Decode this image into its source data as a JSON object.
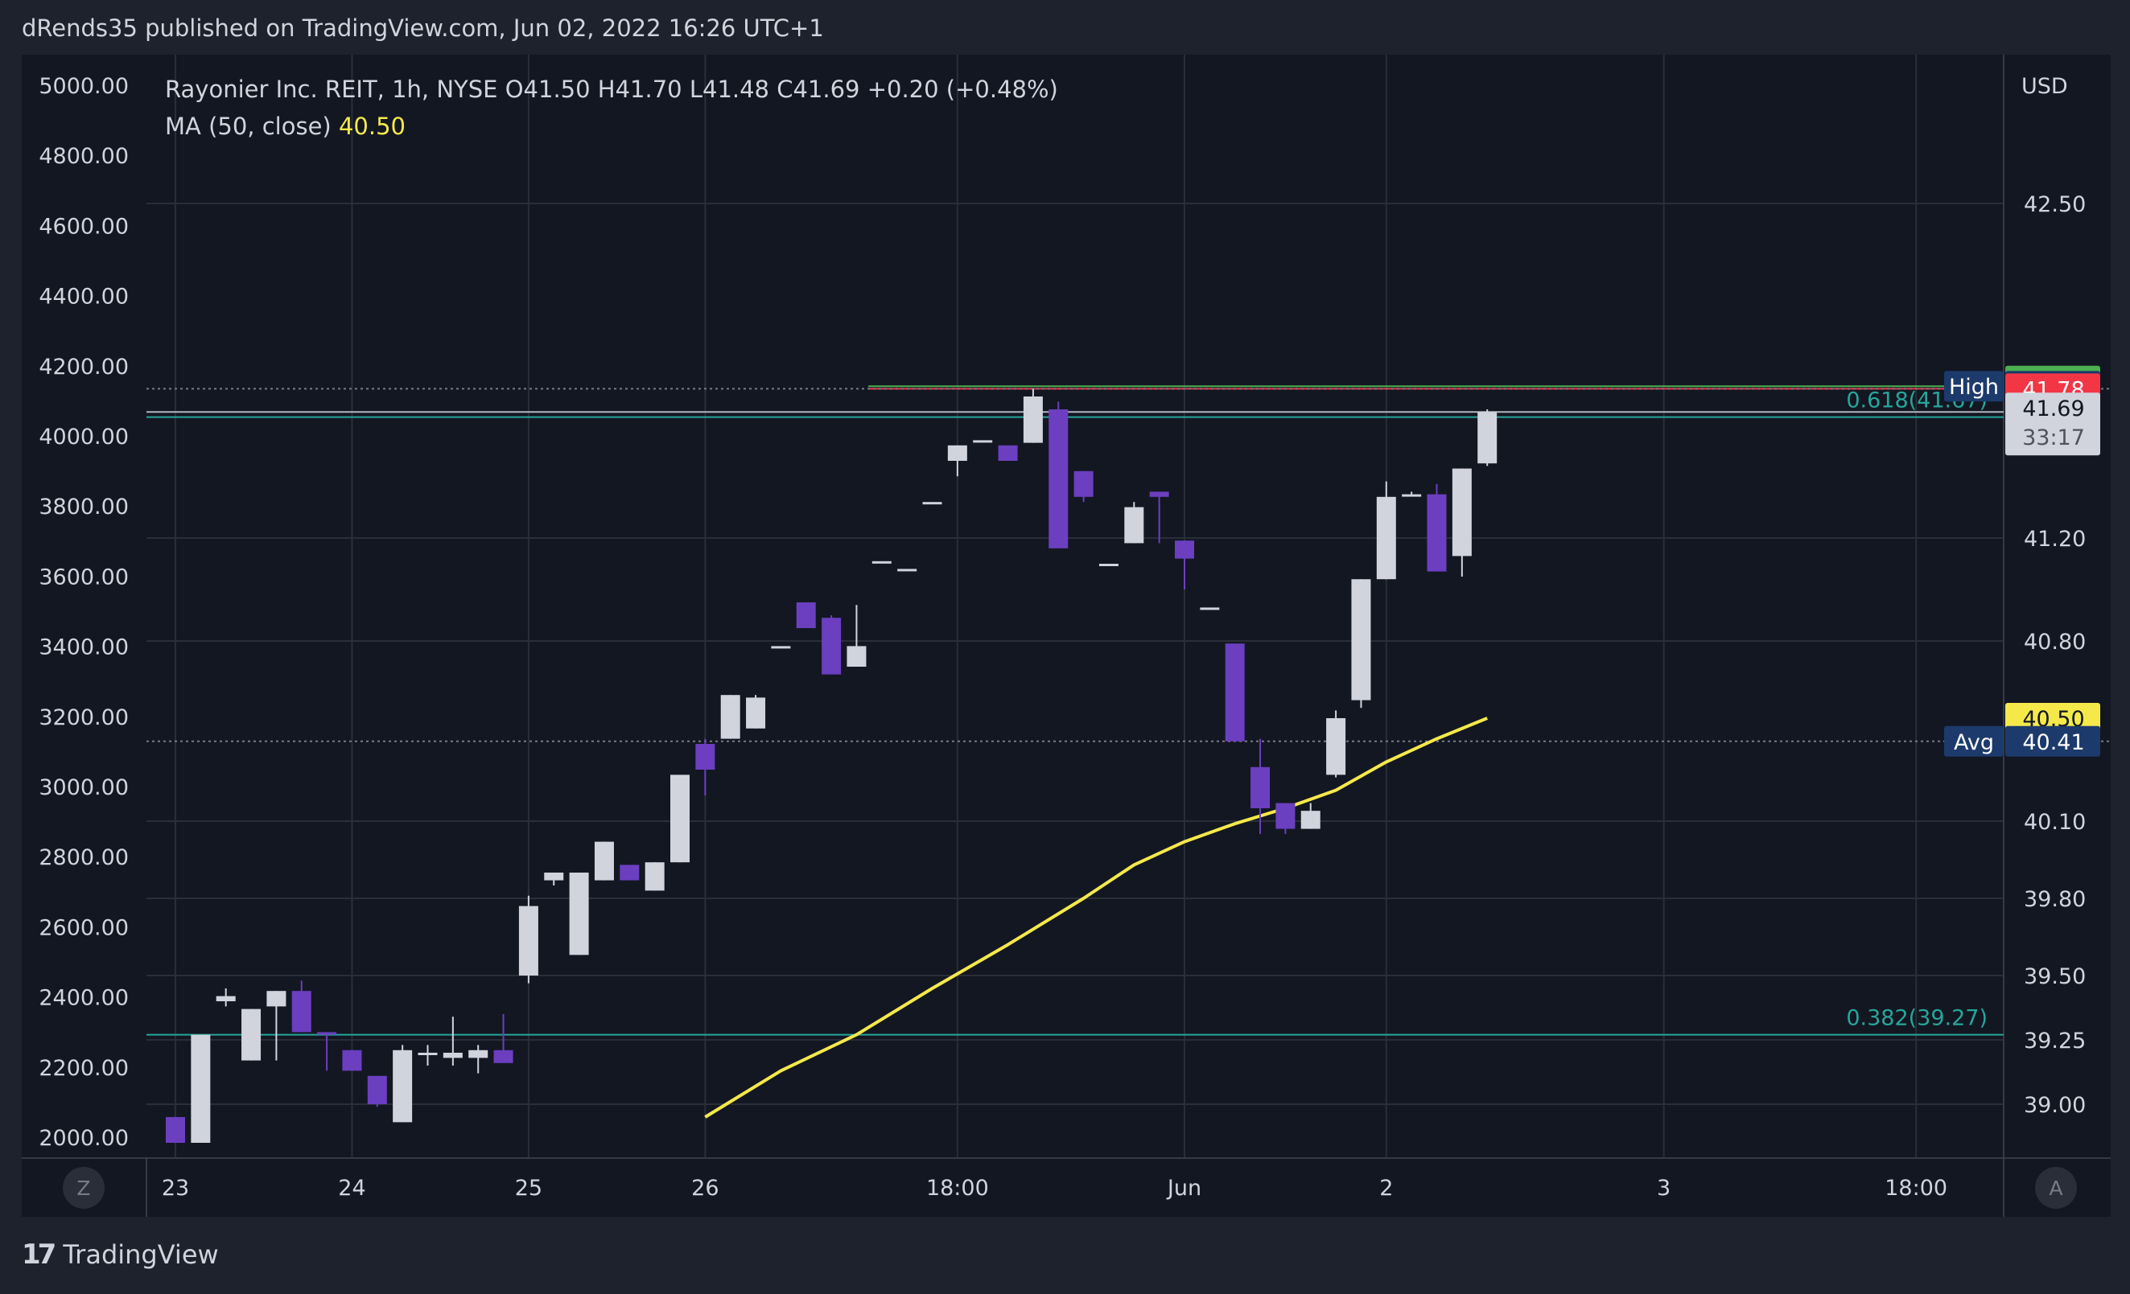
{
  "header": {
    "published_text": "dRends35 published on TradingView.com, Jun 02, 2022 16:26 UTC+1"
  },
  "legend": {
    "line1": "Rayonier Inc. REIT, 1h, NYSE  O41.50  H41.70  L41.48  C41.69  +0.20 (+0.48%)",
    "ma_label": "MA (50, close)",
    "ma_value": "40.50"
  },
  "footer": {
    "brand": "TradingView",
    "logo_icon": "tradingview-logo-icon"
  },
  "buttons": {
    "left_axis_button": "Z",
    "right_axis_button": "A"
  },
  "colors": {
    "background": "#131722",
    "up_candle": "#d1d4dc",
    "down_candle": "#6b3fc0",
    "ma_line": "#f5e94a",
    "fib_line": "#26a69a",
    "green_badge": "#4caf50",
    "red_badge": "#f23645",
    "navy_badge": "#1c3a6b"
  },
  "chart_data": {
    "type": "candlestick",
    "symbol": "Rayonier Inc. REIT",
    "interval": "1h",
    "exchange": "NYSE",
    "currency": "USD",
    "right_axis_ticks": [
      42.5,
      41.2,
      40.8,
      40.1,
      39.8,
      39.5,
      39.25,
      39.0
    ],
    "right_axis_tick_labels": [
      "42.50",
      "41.20",
      "40.80",
      "40.10",
      "39.80",
      "39.50",
      "39.25",
      "39.00"
    ],
    "left_axis_ticks": [
      5000,
      4800,
      4600,
      4400,
      4200,
      4000,
      3800,
      3600,
      3400,
      3200,
      3000,
      2800,
      2600,
      2400,
      2200,
      2000
    ],
    "left_axis_tick_labels": [
      "5000.00",
      "4800.00",
      "4600.00",
      "4400.00",
      "4200.00",
      "4000.00",
      "3800.00",
      "3600.00",
      "3400.00",
      "3200.00",
      "3000.00",
      "2800.00",
      "2600.00",
      "2400.00",
      "2200.00",
      "2000.00"
    ],
    "x_tick_labels": [
      {
        "label": "23",
        "index": 0
      },
      {
        "label": "24",
        "index": 7
      },
      {
        "label": "25",
        "index": 14
      },
      {
        "label": "26",
        "index": 21
      },
      {
        "label": "18:00",
        "index": 31
      },
      {
        "label": "Jun",
        "index": 40
      },
      {
        "label": "2",
        "index": 48
      },
      {
        "label": "3",
        "index": 59
      },
      {
        "label": "18:00",
        "index": 69
      }
    ],
    "candles": [
      {
        "o": 38.95,
        "h": 38.95,
        "l": 38.85,
        "c": 38.85
      },
      {
        "o": 38.85,
        "h": 39.27,
        "l": 38.85,
        "c": 39.27
      },
      {
        "o": 39.4,
        "h": 39.45,
        "l": 39.38,
        "c": 39.42
      },
      {
        "o": 39.17,
        "h": 39.37,
        "l": 39.17,
        "c": 39.37
      },
      {
        "o": 39.38,
        "h": 39.44,
        "l": 39.17,
        "c": 39.44
      },
      {
        "o": 39.44,
        "h": 39.48,
        "l": 39.28,
        "c": 39.28
      },
      {
        "o": 39.28,
        "h": 39.28,
        "l": 39.13,
        "c": 39.27
      },
      {
        "o": 39.21,
        "h": 39.21,
        "l": 39.13,
        "c": 39.13
      },
      {
        "o": 39.11,
        "h": 39.11,
        "l": 38.99,
        "c": 39.0
      },
      {
        "o": 38.93,
        "h": 39.23,
        "l": 38.93,
        "c": 39.21
      },
      {
        "o": 39.2,
        "h": 39.23,
        "l": 39.15,
        "c": 39.2
      },
      {
        "o": 39.18,
        "h": 39.34,
        "l": 39.15,
        "c": 39.2
      },
      {
        "o": 39.18,
        "h": 39.23,
        "l": 39.12,
        "c": 39.21
      },
      {
        "o": 39.21,
        "h": 39.35,
        "l": 39.16,
        "c": 39.16
      },
      {
        "o": 39.5,
        "h": 39.81,
        "l": 39.47,
        "c": 39.77
      },
      {
        "o": 39.87,
        "h": 39.9,
        "l": 39.85,
        "c": 39.9
      },
      {
        "o": 39.58,
        "h": 39.9,
        "l": 39.58,
        "c": 39.9
      },
      {
        "o": 39.87,
        "h": 40.02,
        "l": 39.87,
        "c": 40.02
      },
      {
        "o": 39.93,
        "h": 39.93,
        "l": 39.87,
        "c": 39.87
      },
      {
        "o": 39.83,
        "h": 39.94,
        "l": 39.83,
        "c": 39.94
      },
      {
        "o": 39.94,
        "h": 40.28,
        "l": 39.94,
        "c": 40.28
      },
      {
        "o": 40.4,
        "h": 40.42,
        "l": 40.2,
        "c": 40.3
      },
      {
        "o": 40.42,
        "h": 40.59,
        "l": 40.42,
        "c": 40.59
      },
      {
        "o": 40.46,
        "h": 40.59,
        "l": 40.46,
        "c": 40.58
      },
      {
        "o": 40.78,
        "h": 40.78,
        "l": 40.78,
        "c": 40.78
      },
      {
        "o": 40.95,
        "h": 40.95,
        "l": 40.85,
        "c": 40.85
      },
      {
        "o": 40.89,
        "h": 40.9,
        "l": 40.67,
        "c": 40.67
      },
      {
        "o": 40.7,
        "h": 40.94,
        "l": 40.7,
        "c": 40.78
      },
      {
        "o": 41.11,
        "h": 41.11,
        "l": 41.11,
        "c": 41.11
      },
      {
        "o": 41.08,
        "h": 41.08,
        "l": 41.08,
        "c": 41.08
      },
      {
        "o": 41.34,
        "h": 41.34,
        "l": 41.34,
        "c": 41.34
      },
      {
        "o": 41.5,
        "h": 41.56,
        "l": 41.44,
        "c": 41.56
      },
      {
        "o": 41.58,
        "h": 41.58,
        "l": 41.58,
        "c": 41.58
      },
      {
        "o": 41.56,
        "h": 41.56,
        "l": 41.5,
        "c": 41.5
      },
      {
        "o": 41.57,
        "h": 41.78,
        "l": 41.57,
        "c": 41.75
      },
      {
        "o": 41.7,
        "h": 41.73,
        "l": 41.16,
        "c": 41.16
      },
      {
        "o": 41.46,
        "h": 41.46,
        "l": 41.34,
        "c": 41.36
      },
      {
        "o": 41.1,
        "h": 41.1,
        "l": 41.1,
        "c": 41.1
      },
      {
        "o": 41.18,
        "h": 41.34,
        "l": 41.18,
        "c": 41.32
      },
      {
        "o": 41.38,
        "h": 41.38,
        "l": 41.18,
        "c": 41.36
      },
      {
        "o": 41.19,
        "h": 41.19,
        "l": 41.0,
        "c": 41.12
      },
      {
        "o": 40.93,
        "h": 40.93,
        "l": 40.93,
        "c": 40.93
      },
      {
        "o": 40.79,
        "h": 40.79,
        "l": 40.41,
        "c": 40.41
      },
      {
        "o": 40.31,
        "h": 40.42,
        "l": 40.05,
        "c": 40.15
      },
      {
        "o": 40.17,
        "h": 40.17,
        "l": 40.05,
        "c": 40.07
      },
      {
        "o": 40.07,
        "h": 40.17,
        "l": 40.07,
        "c": 40.14
      },
      {
        "o": 40.28,
        "h": 40.53,
        "l": 40.27,
        "c": 40.5
      },
      {
        "o": 40.57,
        "h": 41.04,
        "l": 40.54,
        "c": 41.04
      },
      {
        "o": 41.04,
        "h": 41.42,
        "l": 41.04,
        "c": 41.36
      },
      {
        "o": 41.37,
        "h": 41.38,
        "l": 41.37,
        "c": 41.37
      },
      {
        "o": 41.37,
        "h": 41.41,
        "l": 41.07,
        "c": 41.07
      },
      {
        "o": 41.13,
        "h": 41.47,
        "l": 41.05,
        "c": 41.47
      },
      {
        "o": 41.49,
        "h": 41.7,
        "l": 41.48,
        "c": 41.69
      }
    ],
    "ma_50": [
      {
        "i": 21,
        "v": 38.95
      },
      {
        "i": 24,
        "v": 39.13
      },
      {
        "i": 27,
        "v": 39.27
      },
      {
        "i": 30,
        "v": 39.45
      },
      {
        "i": 33,
        "v": 39.62
      },
      {
        "i": 36,
        "v": 39.8
      },
      {
        "i": 38,
        "v": 39.93
      },
      {
        "i": 40,
        "v": 40.02
      },
      {
        "i": 42,
        "v": 40.09
      },
      {
        "i": 44,
        "v": 40.15
      },
      {
        "i": 46,
        "v": 40.22
      },
      {
        "i": 48,
        "v": 40.33
      },
      {
        "i": 50,
        "v": 40.42
      },
      {
        "i": 52,
        "v": 40.5
      }
    ],
    "fib_levels": [
      {
        "ratio": "0.618",
        "value": 41.67,
        "label": "0.618(41.67)"
      },
      {
        "ratio": "0.382",
        "value": 39.27,
        "label": "0.382(39.27)"
      }
    ],
    "horizontal_lines": [
      {
        "value": 41.79,
        "color": "#4caf50",
        "style": "solid"
      },
      {
        "value": 41.78,
        "color": "#f23645",
        "style": "solid"
      },
      {
        "value": 41.69,
        "color": "#b2b5be",
        "style": "solid"
      },
      {
        "value": 41.78,
        "color": "#787b86",
        "style": "dotted"
      },
      {
        "value": 40.41,
        "color": "#787b86",
        "style": "dotted"
      }
    ],
    "price_badges": [
      {
        "label": "",
        "value": "41.81",
        "price": 41.81,
        "color": "#4caf50",
        "text_color": "#ffffff"
      },
      {
        "label": "High",
        "value": "41.79",
        "price": 41.79,
        "color": "#1c3a6b",
        "text_color": "#ffffff"
      },
      {
        "label": "",
        "value": "41.78",
        "price": 41.78,
        "color": "#f23645",
        "text_color": "#ffffff"
      },
      {
        "label": "",
        "value": "41.69",
        "price": 41.69,
        "color": "#d1d4dc",
        "text_color": "#131722",
        "sub": "33:17"
      },
      {
        "label": "",
        "value": "40.50",
        "price": 40.5,
        "color": "#f5e94a",
        "text_color": "#131722"
      },
      {
        "label": "Avg",
        "value": "40.41",
        "price": 40.41,
        "color": "#1c3a6b",
        "text_color": "#ffffff"
      }
    ],
    "grid": true
  }
}
